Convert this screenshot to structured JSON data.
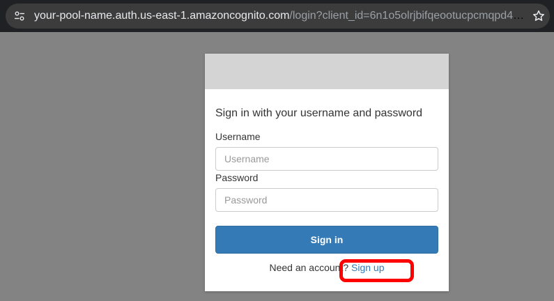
{
  "browser": {
    "url_host": "your-pool-name.auth.us-east-1.amazoncognito.com",
    "url_path": "/login?client_id=6n1o5olrjbifqeootucpcmqpd4&response_type=code&scope=email+openid+phone&redirect_uri=...",
    "site_info_icon": "tune-icon",
    "bookmark_icon": "star-icon"
  },
  "login_card": {
    "title": "Sign in with your username and password",
    "username_label": "Username",
    "username_placeholder": "Username",
    "username_value": "",
    "password_label": "Password",
    "password_placeholder": "Password",
    "password_value": "",
    "signin_label": "Sign in",
    "signup_prompt": "Need an account? ",
    "signup_link": "Sign up"
  },
  "colors": {
    "page_background": "#838383",
    "banner": "#d4d4d4",
    "primary_button": "#337ab7",
    "highlight": "#ff0000"
  }
}
